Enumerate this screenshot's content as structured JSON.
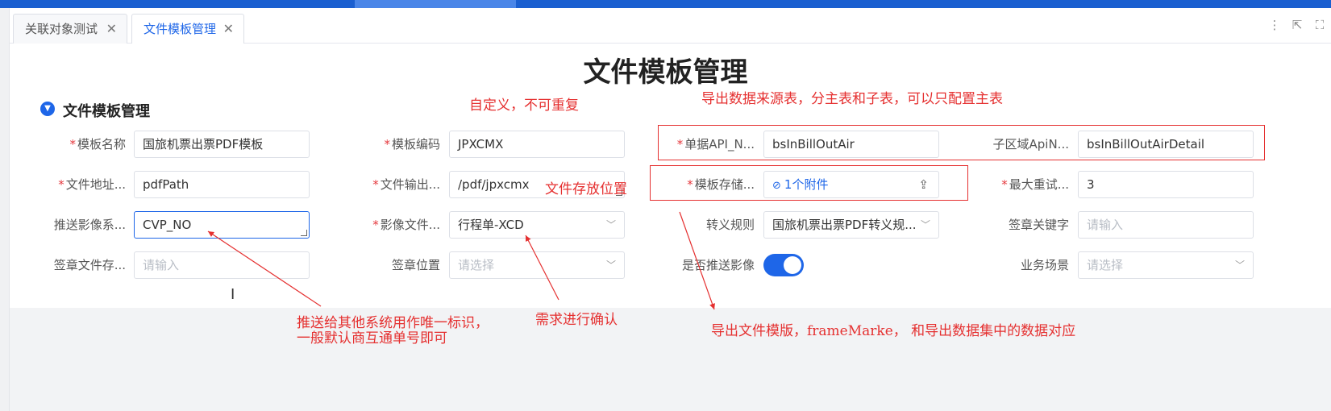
{
  "tabs": [
    {
      "label": "关联对象测试",
      "close": "✕"
    },
    {
      "label": "文件模板管理",
      "close": "✕"
    }
  ],
  "toolbar": {
    "more": "⋮",
    "collapse": "⇱",
    "fullscreen": "⛶"
  },
  "page_title": "文件模板管理",
  "section_title": "文件模板管理",
  "form": {
    "template_name": {
      "label": "模板名称",
      "value": "国旅机票出票PDF模板"
    },
    "template_code": {
      "label": "模板编码",
      "value": "JPXCMX"
    },
    "bill_api": {
      "label": "单据API_N...",
      "value": "bsInBillOutAir"
    },
    "sub_api": {
      "label": "子区域ApiN...",
      "value": "bsInBillOutAirDetail"
    },
    "file_addr": {
      "label": "文件地址...",
      "value": "pdfPath"
    },
    "file_output": {
      "label": "文件输出...",
      "value": "/pdf/jpxcmx"
    },
    "template_storage": {
      "label": "模板存储...",
      "value": "1个附件"
    },
    "max_retry": {
      "label": "最大重试...",
      "value": "3"
    },
    "push_image": {
      "label": "推送影像系...",
      "value": "CVP_NO"
    },
    "image_file": {
      "label": "影像文件...",
      "value": "行程单-XCD"
    },
    "escape_rule": {
      "label": "转义规则",
      "value": "国旅机票出票PDF转义规..."
    },
    "sign_keyword": {
      "label": "签章关键字",
      "placeholder": "请输入"
    },
    "sign_file_store": {
      "label": "签章文件存...",
      "placeholder": "请输入"
    },
    "sign_position": {
      "label": "签章位置",
      "placeholder": "请选择"
    },
    "push_flag": {
      "label": "是否推送影像",
      "on": true
    },
    "business_scene": {
      "label": "业务场景",
      "placeholder": "请选择"
    }
  },
  "annotations": {
    "a1": "自定义，不可重复",
    "a2": "导出数据来源表，分主表和子表，可以只配置主表",
    "a3": "文件存放位置",
    "a4_line1": "推送给其他系统用作唯一标识，",
    "a4_line2": "一般默认商互通单号即可",
    "a5": "需求进行确认",
    "a6": "导出文件模版，frameMarke， 和导出数据集中的数据对应"
  },
  "colors": {
    "primary": "#1e66e8",
    "required": "#e5393e",
    "annotation": "#e53030"
  }
}
